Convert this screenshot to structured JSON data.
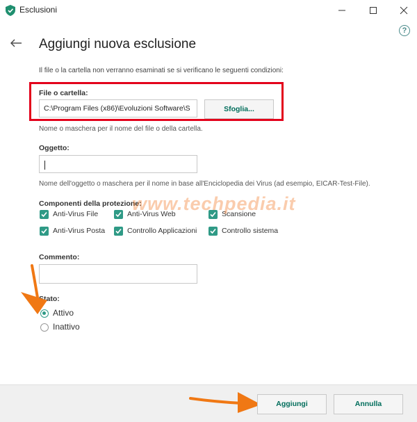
{
  "window": {
    "title": "Esclusioni"
  },
  "titlebar": {
    "minimize_icon": "minimize-icon",
    "maximize_icon": "maximize-icon",
    "close_icon": "close-icon"
  },
  "help": {
    "label": "?"
  },
  "page": {
    "heading": "Aggiungi nuova esclusione",
    "intro": "Il file o la cartella non verranno esaminati se si verificano le seguenti condizioni:"
  },
  "file_field": {
    "label": "File o cartella:",
    "value": "C:\\Program Files (x86)\\Evoluzioni Software\\S",
    "browse_label": "Sfoglia...",
    "hint": "Nome o maschera per il nome del file o della cartella."
  },
  "object_field": {
    "label": "Oggetto:",
    "value": "",
    "hint": "Nome dell'oggetto o maschera per il nome in base all'Enciclopedia dei Virus (ad esempio, EICAR-Test-File)."
  },
  "components": {
    "label": "Componenti della protezione:",
    "items": [
      {
        "label": "Anti-Virus File",
        "checked": true
      },
      {
        "label": "Anti-Virus Web",
        "checked": true
      },
      {
        "label": "Scansione",
        "checked": true
      },
      {
        "label": "Anti-Virus Posta",
        "checked": true
      },
      {
        "label": "Controllo Applicazioni",
        "checked": true
      },
      {
        "label": "Controllo sistema",
        "checked": true
      }
    ]
  },
  "comment_field": {
    "label": "Commento:",
    "value": ""
  },
  "status": {
    "label": "Stato:",
    "options": [
      {
        "label": "Attivo",
        "selected": true
      },
      {
        "label": "Inattivo",
        "selected": false
      }
    ]
  },
  "footer": {
    "add_label": "Aggiungi",
    "cancel_label": "Annulla"
  },
  "watermark": "www.techpedia.it",
  "colors": {
    "accent": "#2f9a86",
    "button_text": "#006d5b",
    "highlight_box": "#e3001b",
    "arrow": "#f07814"
  }
}
